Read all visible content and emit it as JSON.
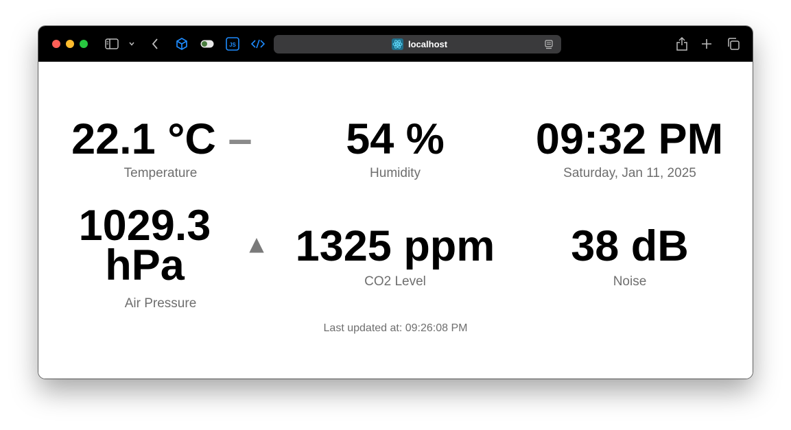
{
  "browser": {
    "url": "localhost",
    "icons": {
      "sidebar": "sidebar-icon",
      "sidebar_menu": "chevron-down-icon",
      "back": "chevron-left-icon",
      "ext1": "cube-icon",
      "ext2": "toggle-icon",
      "ext3": "js-icon",
      "ext4": "code-icon",
      "site": "react-icon",
      "reader": "reader-icon",
      "share": "share-icon",
      "new_tab": "plus-icon",
      "tabs": "tabs-icon"
    },
    "colors": {
      "close": "#ff5f57",
      "minimize": "#febc2e",
      "zoom": "#28c840",
      "ext_blue": "#1e8cff"
    }
  },
  "dashboard": {
    "temperature": {
      "value": "22.1 °C",
      "trend": "–",
      "label": "Temperature"
    },
    "humidity": {
      "value": "54 %",
      "label": "Humidity"
    },
    "time": {
      "value": "09:32 PM",
      "date": "Saturday, Jan 11, 2025"
    },
    "pressure": {
      "value_line1": "1029.3",
      "value_line2": "hPa",
      "trend": "▲",
      "label": "Air Pressure"
    },
    "co2": {
      "value": "1325 ppm",
      "label": "CO2 Level"
    },
    "noise": {
      "value": "38 dB",
      "label": "Noise"
    },
    "last_updated": "Last updated at: 09:26:08 PM"
  }
}
